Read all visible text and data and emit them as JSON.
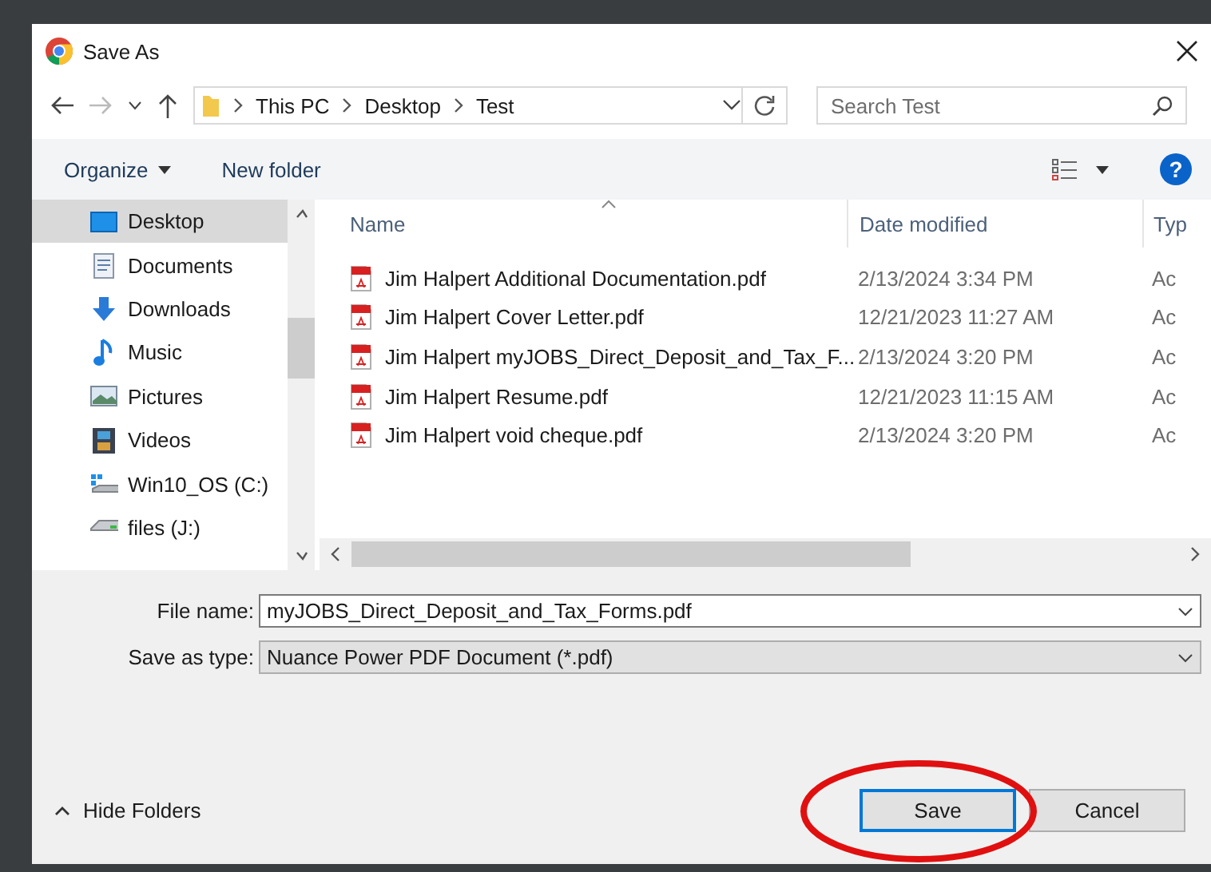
{
  "window": {
    "title": "Save As"
  },
  "address": {
    "path": [
      "This PC",
      "Desktop",
      "Test"
    ]
  },
  "search": {
    "placeholder": "Search Test"
  },
  "toolbar": {
    "organize": "Organize",
    "new_folder": "New folder",
    "help": "?"
  },
  "nav": {
    "items": [
      {
        "label": "Desktop",
        "kind": "desktop",
        "selected": true
      },
      {
        "label": "Documents",
        "kind": "documents",
        "selected": false
      },
      {
        "label": "Downloads",
        "kind": "downloads",
        "selected": false
      },
      {
        "label": "Music",
        "kind": "music",
        "selected": false
      },
      {
        "label": "Pictures",
        "kind": "pictures",
        "selected": false
      },
      {
        "label": "Videos",
        "kind": "videos",
        "selected": false
      },
      {
        "label": "Win10_OS (C:)",
        "kind": "system-drive",
        "selected": false
      },
      {
        "label": "files (J:)",
        "kind": "drive",
        "selected": false
      }
    ]
  },
  "files": {
    "columns": [
      "Name",
      "Date modified",
      "Typ"
    ],
    "rows": [
      {
        "name": "Jim Halpert Additional Documentation.pdf",
        "date": "2/13/2024 3:34 PM",
        "type": "Ac"
      },
      {
        "name": "Jim Halpert Cover Letter.pdf",
        "date": "12/21/2023 11:27 AM",
        "type": "Ac"
      },
      {
        "name": "Jim Halpert myJOBS_Direct_Deposit_and_Tax_F...",
        "date": "2/13/2024 3:20 PM",
        "type": "Ac"
      },
      {
        "name": "Jim Halpert Resume.pdf",
        "date": "12/21/2023 11:15 AM",
        "type": "Ac"
      },
      {
        "name": "Jim Halpert void cheque.pdf",
        "date": "2/13/2024 3:20 PM",
        "type": "Ac"
      }
    ]
  },
  "file_name": {
    "label": "File name:",
    "value": "myJOBS_Direct_Deposit_and_Tax_Forms.pdf"
  },
  "save_type": {
    "label": "Save as type:",
    "value": "Nuance Power PDF Document (*.pdf)"
  },
  "hide_folders": "Hide Folders",
  "buttons": [
    {
      "label": "Save",
      "default": true
    },
    {
      "label": "Cancel",
      "default": false
    }
  ]
}
